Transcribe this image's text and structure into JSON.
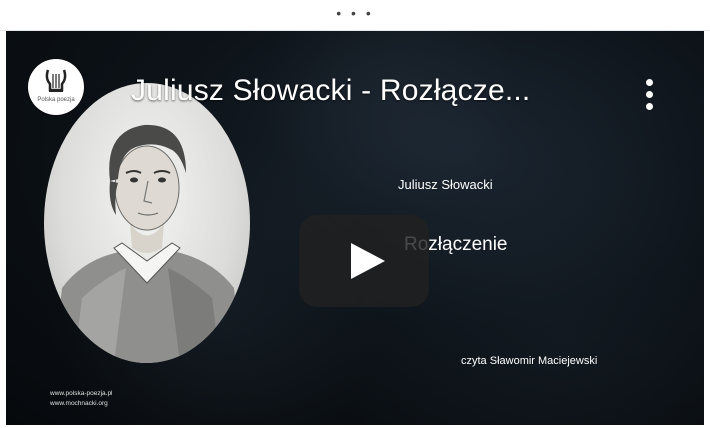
{
  "topbar": {
    "dots": "• • •"
  },
  "video": {
    "channel_name": "Polska poezja",
    "title": "Juliusz Słowacki - Rozłącze...",
    "author": "Juliusz Słowacki",
    "poem": "Rozłączenie",
    "reader": "czyta Sławomir Maciejewski",
    "credits": [
      "www.polska-poezja.pl",
      "www.mochnacki.org"
    ],
    "icons": {
      "lyre": "lyre-icon",
      "menu": "more-vertical-icon",
      "play": "play-icon"
    }
  },
  "colors": {
    "background": "#0d1319",
    "play_button": "#212121",
    "text": "#ffffff"
  }
}
